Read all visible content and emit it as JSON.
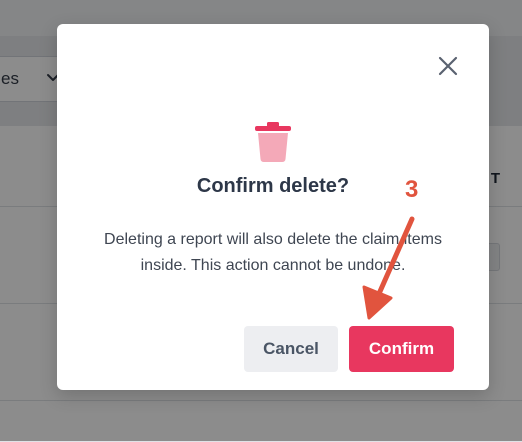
{
  "background": {
    "select_partial_text": "es",
    "column_header_partial": "T"
  },
  "modal": {
    "title": "Confirm delete?",
    "message": "Deleting a report will also delete the claim items inside. This action cannot be undone.",
    "cancel_label": "Cancel",
    "confirm_label": "Confirm",
    "icons": {
      "close": "close-icon",
      "trash": "trash-icon"
    }
  },
  "annotation": {
    "step_number": "3"
  },
  "colors": {
    "confirm": "#e8375f",
    "cancel_bg": "#edeef1",
    "trash_icon": "#f4a9b8",
    "annotation": "#e1543e"
  }
}
